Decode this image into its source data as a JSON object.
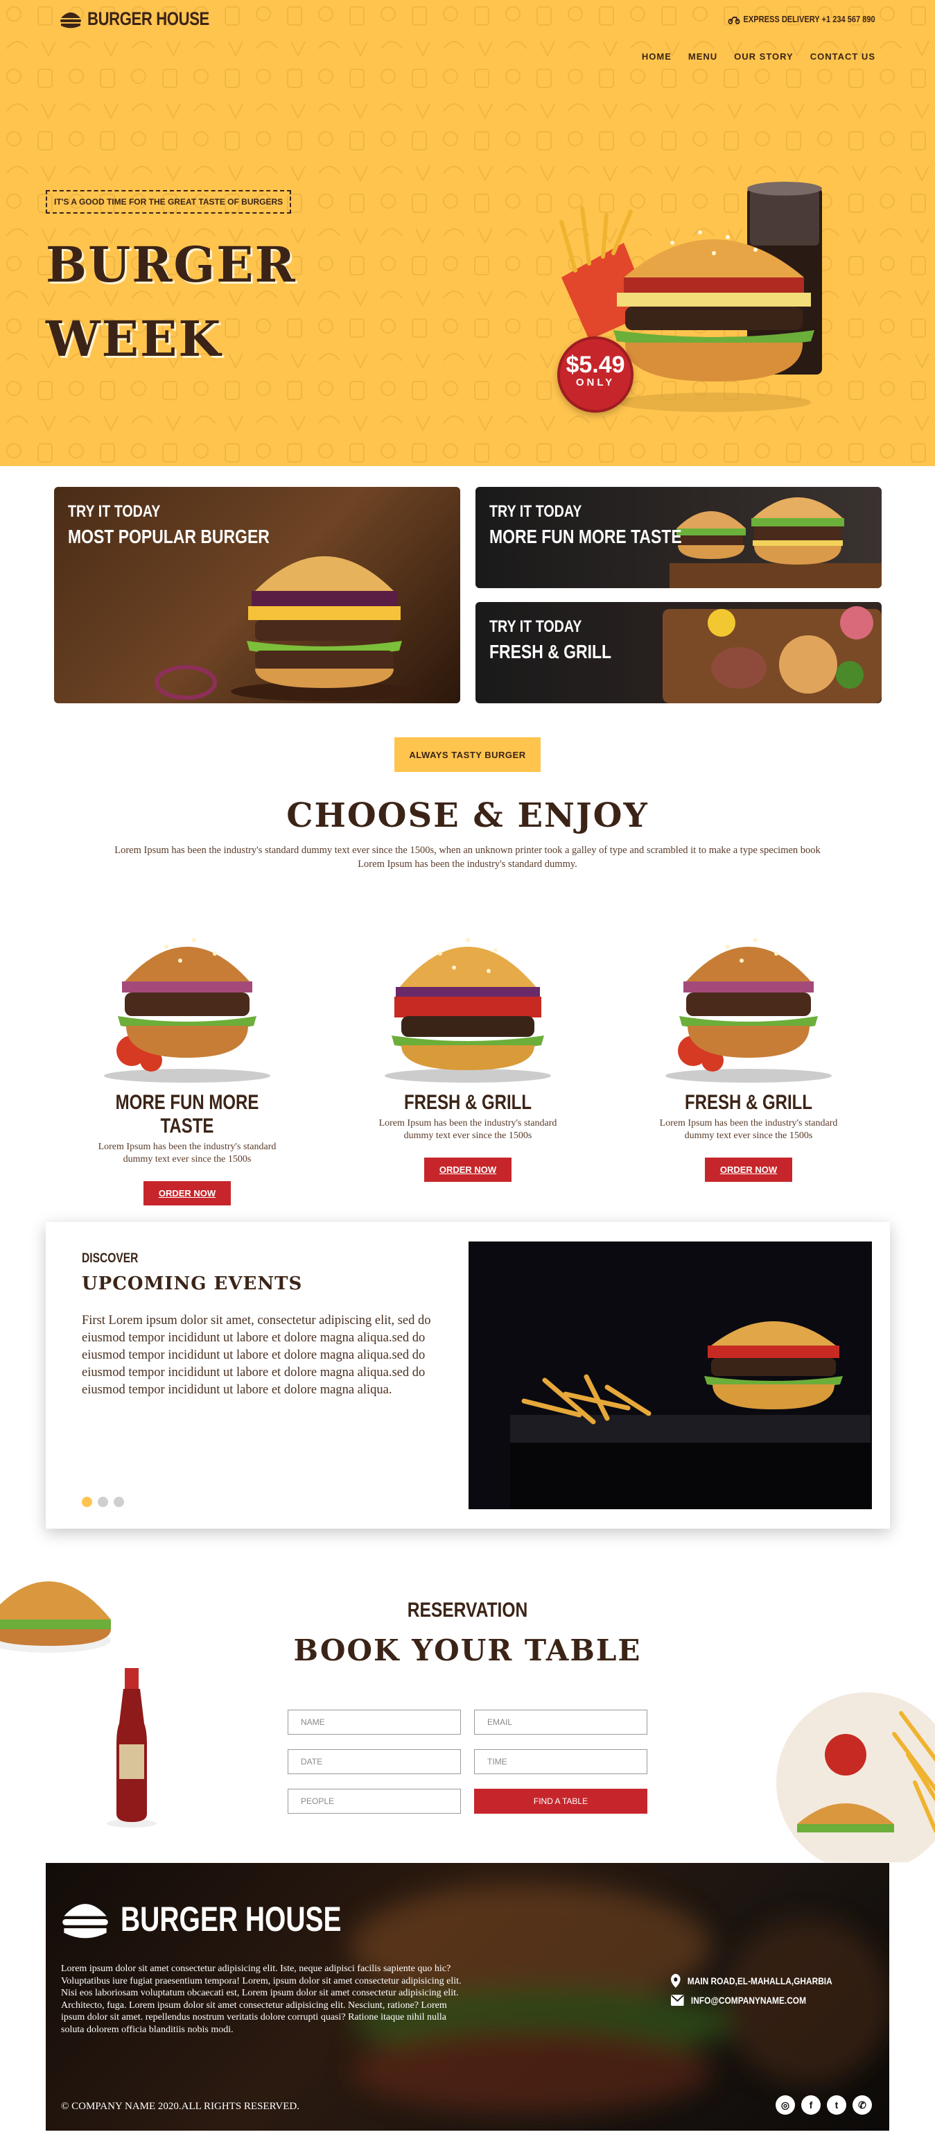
{
  "header": {
    "logo_text": "BURGER HOUSE",
    "delivery": "EXPRESS DELIVERY +1 234 567 890",
    "nav": [
      "HOME",
      "MENU",
      "OUR STORY",
      "CONTACT US"
    ]
  },
  "hero": {
    "tagline": "IT'S A GOOD TIME FOR THE GREAT TASTE OF BURGERS",
    "title_line1": "BURGER",
    "title_line2": "WEEK",
    "price": "$5.49",
    "price_note": "ONLY"
  },
  "promos": [
    {
      "kicker": "TRY IT TODAY",
      "title": "MOST POPULAR BURGER"
    },
    {
      "kicker": "TRY IT TODAY",
      "title": "MORE FUN MORE TASTE"
    },
    {
      "kicker": "TRY IT TODAY",
      "title": "FRESH & GRILL"
    }
  ],
  "choose": {
    "badge": "ALWAYS TASTY BURGER",
    "title": "CHOOSE & ENJOY",
    "description": "Lorem Ipsum has been the industry's standard dummy text ever since the 1500s, when an unknown printer took a galley of type and scrambled it to make a type specimen book Lorem Ipsum has been the industry's standard dummy.",
    "products": [
      {
        "name": "MORE FUN MORE TASTE",
        "desc": "Lorem Ipsum has been the industry's standard dummy text ever since the 1500s",
        "button": "ORDER NOW"
      },
      {
        "name": "FRESH & GRILL",
        "desc": "Lorem Ipsum has been the industry's standard dummy text ever since the 1500s",
        "button": "ORDER NOW"
      },
      {
        "name": "FRESH & GRILL",
        "desc": "Lorem Ipsum has been the industry's standard dummy text ever since the 1500s",
        "button": "ORDER NOW"
      }
    ]
  },
  "events": {
    "kicker": "DISCOVER",
    "title": "UPCOMING EVENTS",
    "text": "First Lorem ipsum dolor sit amet, consectetur adipiscing elit, sed do eiusmod tempor incididunt ut labore et dolore magna aliqua.sed do eiusmod tempor incididunt ut labore et dolore magna aliqua.sed do eiusmod tempor incididunt ut labore et dolore magna aliqua.sed do eiusmod tempor incididunt ut labore et dolore magna aliqua.",
    "slides": 3,
    "active_slide": 1
  },
  "reservation": {
    "kicker": "RESERVATION",
    "title": "BOOK YOUR TABLE",
    "fields": {
      "name": "NAME",
      "email": "EMAIL",
      "date": "DATE",
      "time": "TIME",
      "people": "PEOPLE"
    },
    "button": "FIND A TABLE"
  },
  "footer": {
    "logo_text": "BURGER HOUSE",
    "text": "Lorem ipsum dolor sit amet consectetur adipisicing elit. Iste, neque adipisci facilis sapiente quo hic? Voluptatibus iure fugiat praesentium tempora! Lorem, ipsum dolor sit amet consectetur adipisicing elit. Nisi eos laboriosam voluptatum obcaecati est, Lorem ipsum dolor sit amet consectetur adipisicing elit. Architecto, fuga. Lorem ipsum dolor sit amet consectetur adipisicing elit. Nesciunt, ratione? Lorem ipsum dolor sit amet. repellendus nostrum veritatis dolore corrupti quasi? Ratione itaque nihil nulla soluta dolorem officia blanditiis nobis modi.",
    "address": "MAIN ROAD,EL-MAHALLA,GHARBIA",
    "email": "INFO@COMPANYNAME.COM",
    "copyright": "© COMPANY NAME 2020.ALL RIGHTS RESERVED.",
    "social": [
      "instagram-icon",
      "facebook-icon",
      "twitter-icon",
      "whatsapp-icon"
    ]
  },
  "colors": {
    "accent_yellow": "#ffc44e",
    "brand_red": "#c6262b",
    "text_brown": "#3b2417"
  }
}
